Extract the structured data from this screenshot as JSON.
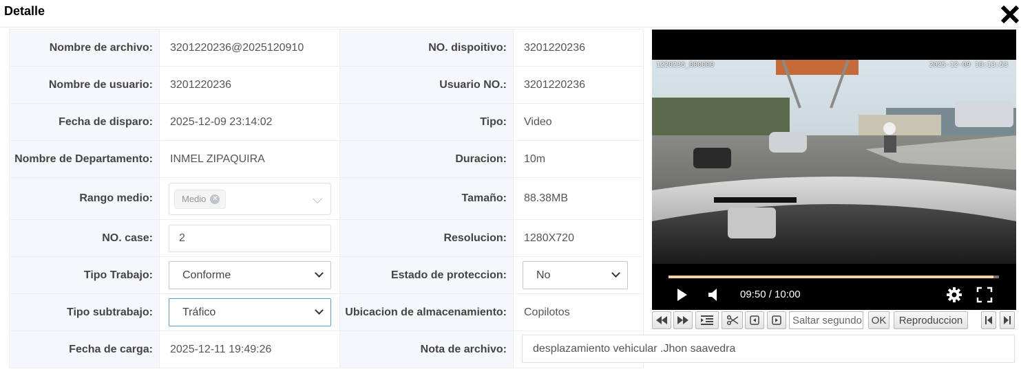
{
  "dialog": {
    "title": "Detalle"
  },
  "rows": [
    {
      "label1": "Nombre de archivo:",
      "value1": "3201220236@2025120910",
      "label2": "NO. dispoitivo:",
      "value2": "3201220236"
    },
    {
      "label1": "Nombre de usuario:",
      "value1": "3201220236",
      "label2": "Usuario NO.:",
      "value2": "3201220236"
    },
    {
      "label1": "Fecha de disparo:",
      "value1": "2025-12-09 23:14:02",
      "label2": "Tipo:",
      "value2": "Video"
    },
    {
      "label1": "Nombre de Departamento:",
      "value1": "INMEL ZIPAQUIRA",
      "label2": "Duracion:",
      "value2": "10m"
    },
    {
      "label1": "Rango medio:",
      "value1_tag": "Medio",
      "label2": "Tamaño:",
      "value2": "88.38MB"
    },
    {
      "label1": "NO. case:",
      "value1_input": "2",
      "label2": "Resolucion:",
      "value2": "1280X720"
    },
    {
      "label1": "Tipo Trabajo:",
      "value1_select": "Conforme",
      "label2": "Estado de proteccion:",
      "value2_select": "No"
    },
    {
      "label1": "Tipo subtrabajo:",
      "value1_select": "Tráfico",
      "label2": "Ubicacion de almacenamiento:",
      "value2": "Copilotos"
    },
    {
      "label1": "Fecha de carga:",
      "value1": "2025-12-11 19:49:26",
      "label2": "Nota de archivo:",
      "value2_input": "desplazamiento vehicular .Jhon saavedra"
    }
  ],
  "player": {
    "osd_left": "1220236_000000",
    "osd_right": "2025-12-09 10:13:53",
    "time": "09:50 / 10:00",
    "progress": 0.983
  },
  "toolbar": {
    "seek_placeholder": "Saltar segundo",
    "ok_label": "OK",
    "playback_label": "Reproduccion"
  },
  "colors": {
    "label_bg": "#f5f7fa",
    "border": "#ebeef5",
    "progress": "#f5d3a0"
  }
}
